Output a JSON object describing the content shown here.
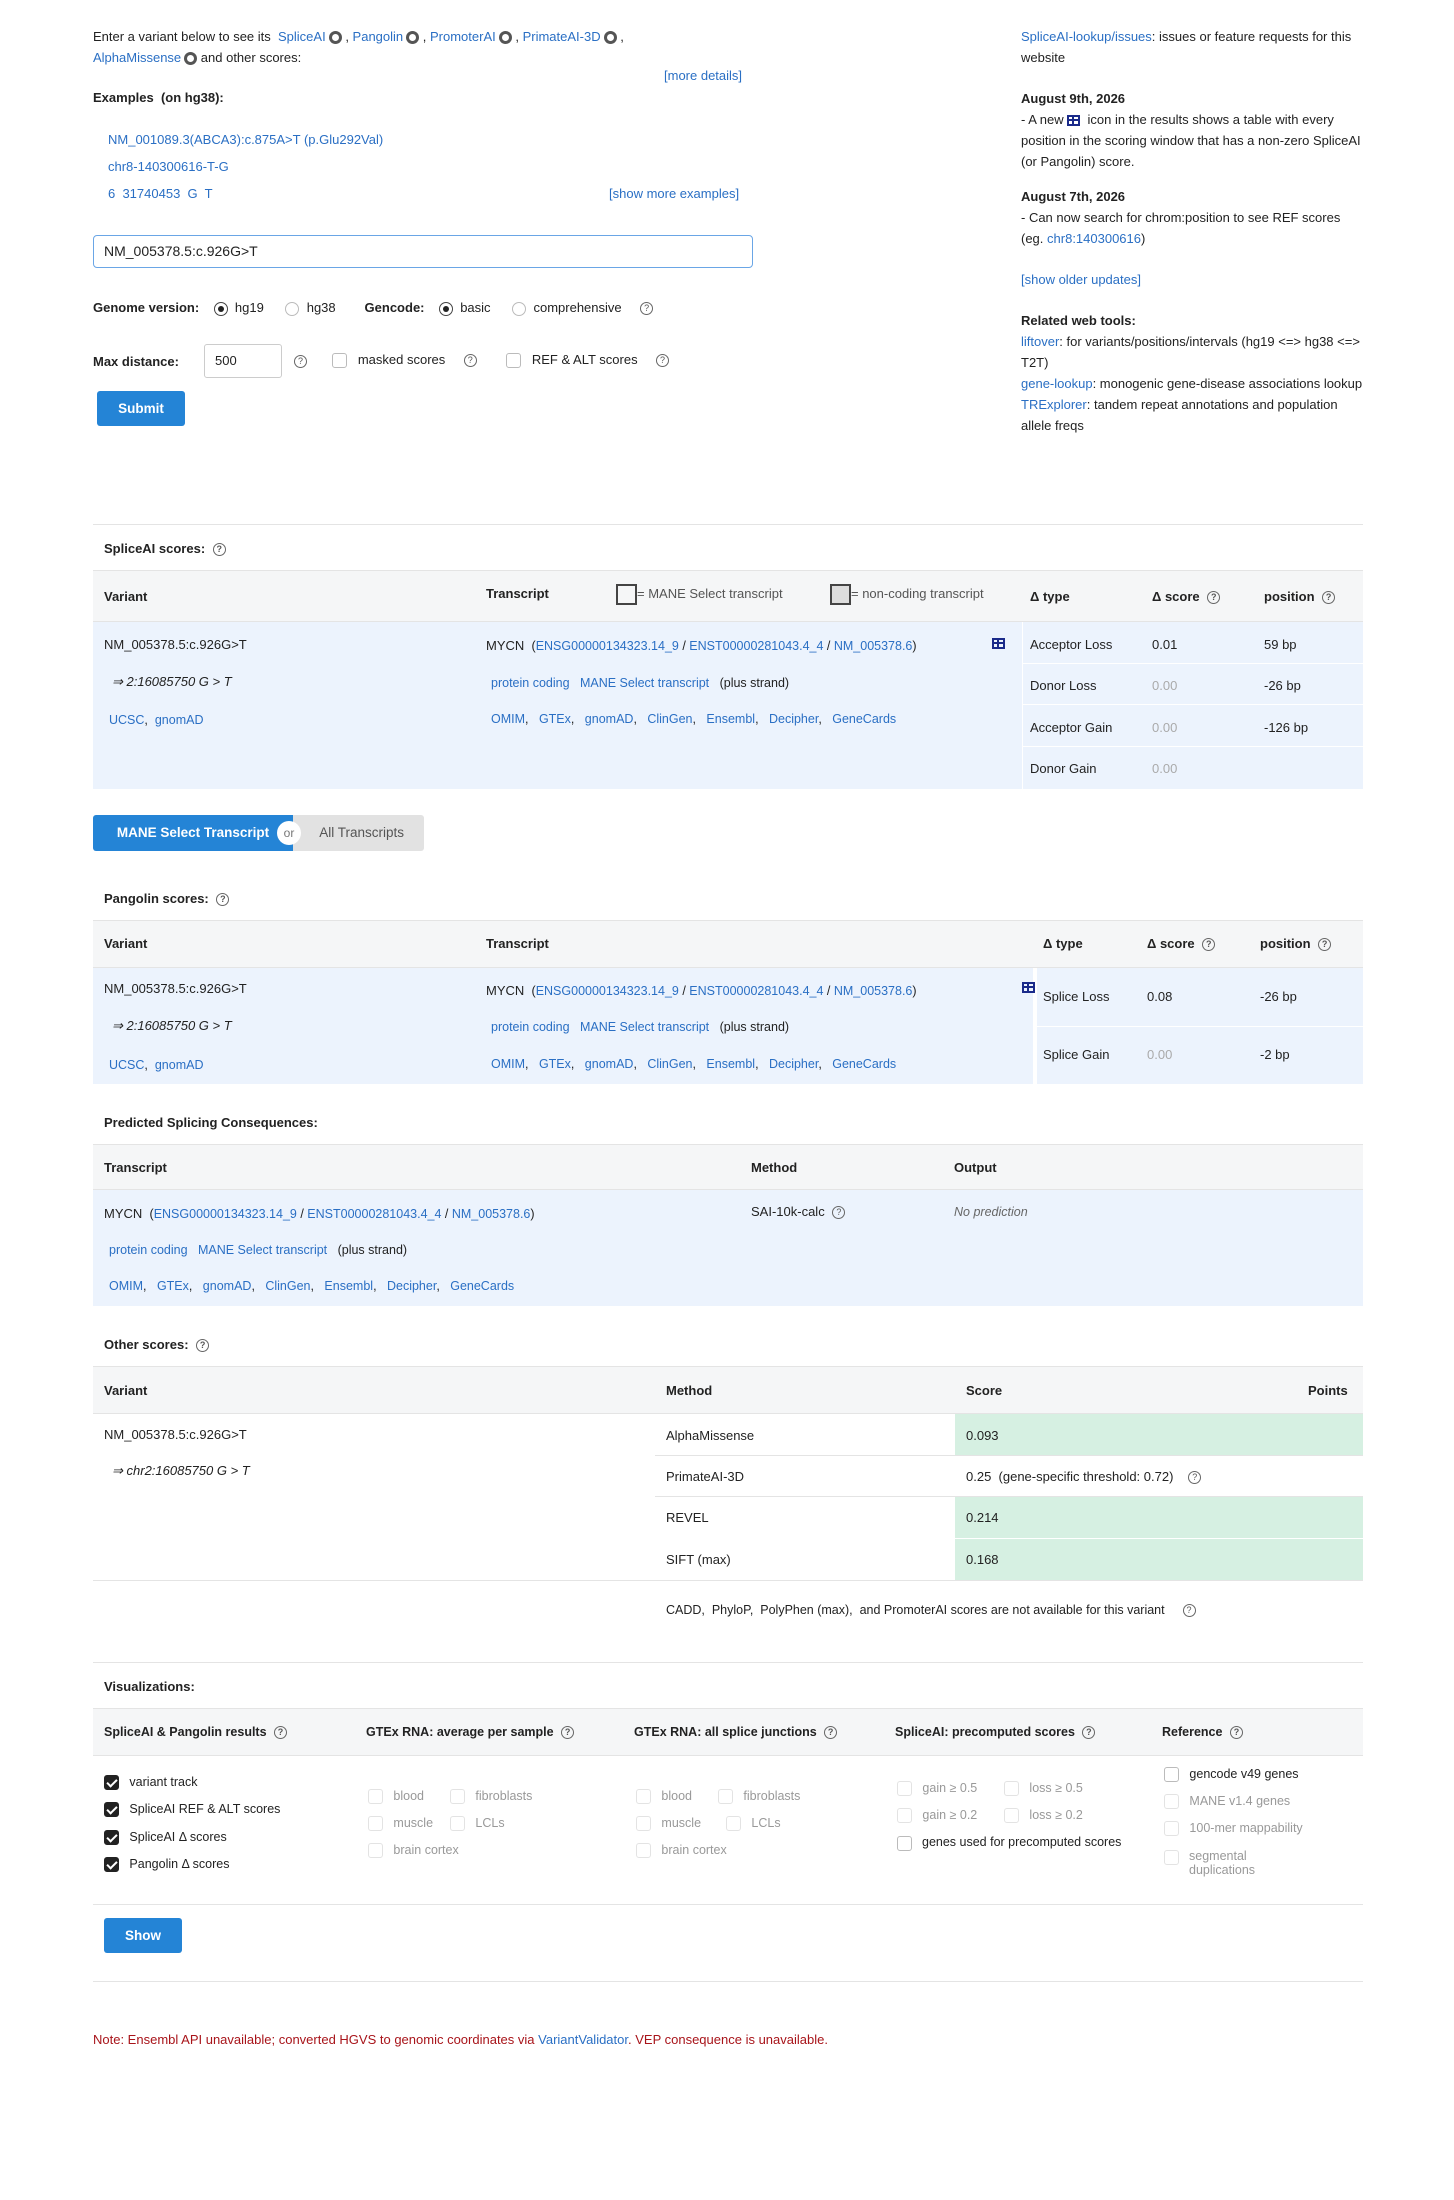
{
  "intro": {
    "text1": "Enter a variant below to see its",
    "spliceai": "SpliceAI",
    "pangolin": "Pangolin",
    "promoterai": "PromoterAI",
    "primateai": "PrimateAI-3D",
    "alphamissense": "AlphaMissense",
    "text2": "and other scores:",
    "more_details": "[more details]"
  },
  "examples": {
    "label": "Examples",
    "sub": "(on hg38):",
    "items": [
      "NM_001089.3(ABCA3):c.875A>T (p.Glu292Val)",
      "chr8-140300616-T-G",
      "6  31740453  G  T"
    ],
    "show_more": "[show more examples]"
  },
  "search": {
    "value": "NM_005378.5:c.926G>T"
  },
  "form": {
    "genome_label": "Genome version:",
    "hg19": "hg19",
    "hg38": "hg38",
    "gencode_label": "Gencode:",
    "basic": "basic",
    "comprehensive": "comprehensive",
    "maxdist_label": "Max distance:",
    "maxdist_value": "500",
    "masked": "masked scores",
    "refalt": "REF & ALT scores",
    "submit": "Submit"
  },
  "sidebar": {
    "issues_link": "SpliceAI-lookup/issues",
    "issues_text": ": issues or feature requests for this website",
    "upd1_date": "August 9th, 2026",
    "upd1_a": "- A new",
    "upd1_b": "icon in the results shows a table with every position in the scoring window that has a non-zero SpliceAI (or Pangolin) score.",
    "upd2_date": "August 7th, 2026",
    "upd2_a": "- Can now search for chrom:position to see REF scores (eg.",
    "upd2_link": "chr8:140300616",
    "upd2_b": ")",
    "older": "[show older updates]",
    "tools_title": "Related web tools:",
    "liftover": "liftover",
    "liftover_text": ": for variants/positions/intervals (hg19 <=> hg38 <=> T2T)",
    "genelookup": "gene-lookup",
    "genelookup_text": ": monogenic gene-disease associations lookup",
    "trexplorer": "TRExplorer",
    "trexplorer_text": ": tandem repeat annotations and population allele freqs"
  },
  "spliceai": {
    "title": "SpliceAI scores:",
    "col_variant": "Variant",
    "col_transcript": "Transcript",
    "legend_mane": "= MANE Select transcript",
    "legend_noncoding": "= non-coding transcript",
    "col_type": "Δ type",
    "col_score": "Δ score",
    "col_position": "position",
    "variant": "NM_005378.5:c.926G>T",
    "coord": "⇒ 2:16085750 G > T",
    "ucsc": "UCSC",
    "gnomad": "gnomAD",
    "gene": "MYCN",
    "ensg": "ENSG00000134323.14_9",
    "enst": "ENST00000281043.4_4",
    "nm": "NM_005378.6",
    "protein_coding": "protein coding",
    "mane": "MANE Select transcript",
    "strand": "(plus strand)",
    "links": [
      "OMIM",
      "GTEx",
      "gnomAD",
      "ClinGen",
      "Ensembl",
      "Decipher",
      "GeneCards"
    ],
    "rows": [
      {
        "type": "Acceptor Loss",
        "score": "0.01",
        "pos": "59 bp"
      },
      {
        "type": "Donor Loss",
        "score": "0.00",
        "pos": "-26 bp"
      },
      {
        "type": "Acceptor Gain",
        "score": "0.00",
        "pos": "-126 bp"
      },
      {
        "type": "Donor Gain",
        "score": "0.00",
        "pos": ""
      }
    ]
  },
  "toggle": {
    "mane": "MANE Select Transcript",
    "or": "or",
    "all": "All Transcripts"
  },
  "pangolin": {
    "title": "Pangolin scores:",
    "col_variant": "Variant",
    "col_transcript": "Transcript",
    "col_type": "Δ type",
    "col_score": "Δ score",
    "col_position": "position",
    "variant": "NM_005378.5:c.926G>T",
    "coord": "⇒ 2:16085750 G > T",
    "ucsc": "UCSC",
    "gnomad": "gnomAD",
    "rows": [
      {
        "type": "Splice Loss",
        "score": "0.08",
        "pos": "-26 bp"
      },
      {
        "type": "Splice Gain",
        "score": "0.00",
        "pos": "-2 bp"
      }
    ]
  },
  "consequences": {
    "title": "Predicted Splicing Consequences:",
    "col_transcript": "Transcript",
    "col_method": "Method",
    "col_output": "Output",
    "method": "SAI-10k-calc",
    "output": "No prediction"
  },
  "other": {
    "title": "Other scores:",
    "col_variant": "Variant",
    "col_method": "Method",
    "col_score": "Score",
    "col_points": "Points",
    "variant": "NM_005378.5:c.926G>T",
    "coord": "⇒ chr2:16085750 G > T",
    "rows": [
      {
        "method": "AlphaMissense",
        "score": "0.093"
      },
      {
        "method": "PrimateAI-3D",
        "score": "0.25  (gene-specific threshold: 0.72)"
      },
      {
        "method": "REVEL",
        "score": "0.214"
      },
      {
        "method": "SIFT (max)",
        "score": "0.168"
      }
    ],
    "unavailable": "CADD,  PhyloP,  PolyPhen (max),  and PromoterAI scores are not available for this variant"
  },
  "viz": {
    "title": "Visualizations:",
    "col1": "SpliceAI & Pangolin results",
    "col2": "GTEx RNA: average per sample",
    "col3": "GTEx RNA: all splice junctions",
    "col4": "SpliceAI: precomputed scores",
    "col5": "Reference",
    "c1": [
      "variant track",
      "SpliceAI REF & ALT scores",
      "SpliceAI Δ  scores",
      "Pangolin Δ  scores"
    ],
    "blood": "blood",
    "fibroblasts": "fibroblasts",
    "muscle": "muscle",
    "lcls": "LCLs",
    "brain": "brain cortex",
    "gain05": "gain ≥ 0.5",
    "loss05": "loss ≥ 0.5",
    "gain02": "gain ≥ 0.2",
    "loss02": "loss ≥ 0.2",
    "genes_used": "genes used for precomputed scores",
    "ref": [
      "gencode v49 genes",
      "MANE v1.4 genes",
      "100-mer mappability",
      "segmental duplications"
    ],
    "show": "Show"
  },
  "note": {
    "a": "Note: Ensembl API unavailable; converted HGVS to genomic coordinates via ",
    "link": "VariantValidator",
    "b": ". VEP consequence is unavailable."
  }
}
